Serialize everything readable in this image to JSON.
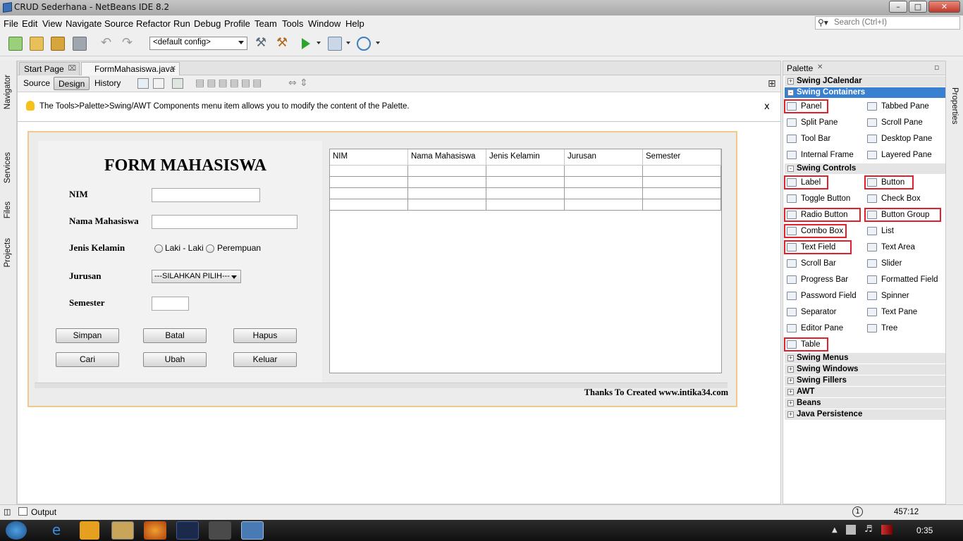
{
  "window": {
    "title": "CRUD Sederhana - NetBeans IDE 8.2"
  },
  "menu": [
    "File",
    "Edit",
    "View",
    "Navigate",
    "Source",
    "Refactor",
    "Run",
    "Debug",
    "Profile",
    "Team",
    "Tools",
    "Window",
    "Help"
  ],
  "search": {
    "placeholder": "Search (Ctrl+I)"
  },
  "toolbar": {
    "config": "<default config>"
  },
  "side_tabs": {
    "navigator": "Navigator",
    "services": "Services",
    "files": "Files",
    "projects": "Projects",
    "properties": "Properties"
  },
  "editor": {
    "tabs": [
      "Start Page",
      "FormMahasiswa.java"
    ],
    "views": [
      "Source",
      "Design",
      "History"
    ],
    "info": "The Tools>Palette>Swing/AWT Components menu item allows you to modify the content of the Palette.",
    "info_close": "x"
  },
  "form": {
    "title": "FORM MAHASISWA",
    "labels": {
      "nim": "NIM",
      "nama": "Nama Mahasiswa",
      "jk": "Jenis Kelamin",
      "jurusan": "Jurusan",
      "semester": "Semester"
    },
    "radio": {
      "male": "Laki - Laki",
      "female": "Perempuan"
    },
    "combo": "---SILAHKAN PILIH---",
    "buttons": {
      "simpan": "Simpan",
      "batal": "Batal",
      "hapus": "Hapus",
      "cari": "Cari",
      "ubah": "Ubah",
      "keluar": "Keluar"
    },
    "table_headers": [
      "NIM",
      "Nama Mahasiswa",
      "Jenis Kelamin",
      "Jurusan",
      "Semester"
    ],
    "credit": "Thanks To Created www.intika34.com"
  },
  "palette": {
    "title": "Palette",
    "categories": {
      "jcalendar": "Swing JCalendar",
      "containers": "Swing Containers",
      "controls": "Swing Controls",
      "menus": "Swing Menus",
      "windows": "Swing Windows",
      "fillers": "Swing Fillers",
      "awt": "AWT",
      "beans": "Beans",
      "persistence": "Java Persistence"
    },
    "containers": [
      "Panel",
      "Tabbed Pane",
      "Split Pane",
      "Scroll Pane",
      "Tool Bar",
      "Desktop Pane",
      "Internal Frame",
      "Layered Pane"
    ],
    "controls": [
      "Label",
      "Button",
      "Toggle Button",
      "Check Box",
      "Radio Button",
      "Button Group",
      "Combo Box",
      "List",
      "Text Field",
      "Text Area",
      "Scroll Bar",
      "Slider",
      "Progress Bar",
      "Formatted Field",
      "Password Field",
      "Spinner",
      "Separator",
      "Text Pane",
      "Editor Pane",
      "Tree",
      "Table"
    ],
    "icon_text": {
      "label": "label",
      "button": "OK",
      "toggle": "ON"
    }
  },
  "output": {
    "label": "Output"
  },
  "status": {
    "position": "457:12",
    "notifications": "1"
  },
  "taskbar": {
    "clock": "0:35"
  }
}
